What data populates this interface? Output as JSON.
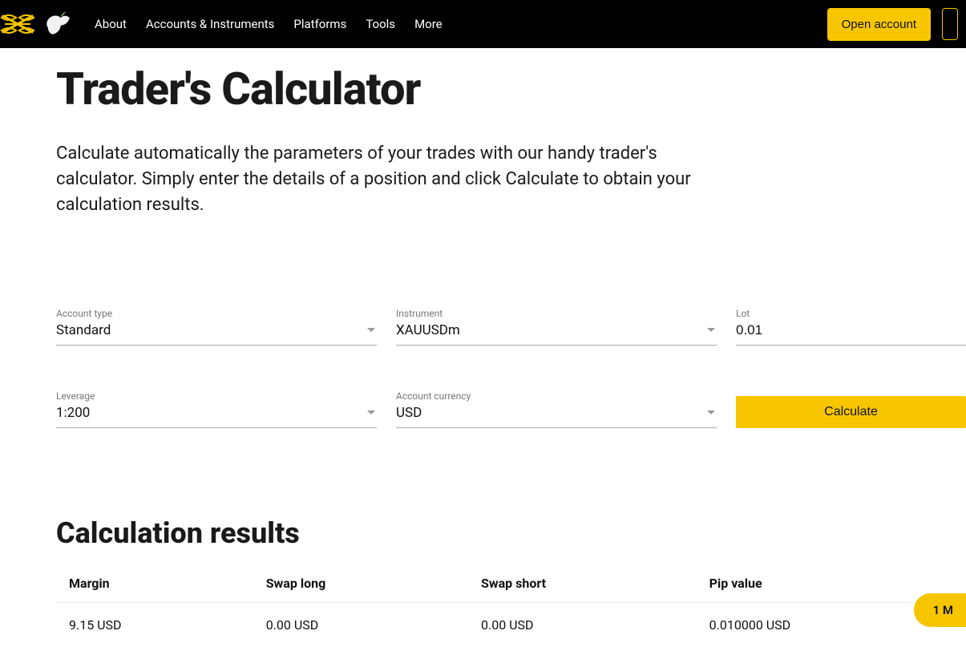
{
  "colors": {
    "accent": "#f7c600"
  },
  "nav": {
    "items": [
      "About",
      "Accounts & Instruments",
      "Platforms",
      "Tools",
      "More"
    ],
    "open_account": "Open account"
  },
  "page": {
    "title": "Trader's Calculator",
    "intro": "Calculate automatically the parameters of your trades with our handy trader's calculator. Simply enter the details of a position and click Calculate to obtain your calculation results."
  },
  "form": {
    "account_type": {
      "label": "Account type",
      "value": "Standard"
    },
    "instrument": {
      "label": "Instrument",
      "value": "XAUUSDm"
    },
    "lot": {
      "label": "Lot",
      "value": "0.01"
    },
    "leverage": {
      "label": "Leverage",
      "value": "1:200"
    },
    "currency": {
      "label": "Account currency",
      "value": "USD"
    },
    "calculate_label": "Calculate"
  },
  "results": {
    "title": "Calculation results",
    "headers": {
      "margin": "Margin",
      "swap_long": "Swap long",
      "swap_short": "Swap short",
      "pip": "Pip value"
    },
    "values": {
      "margin": "9.15 USD",
      "swap_long": "0.00 USD",
      "swap_short": "0.00 USD",
      "pip": "0.010000 USD"
    }
  },
  "float_pill": "1 M"
}
